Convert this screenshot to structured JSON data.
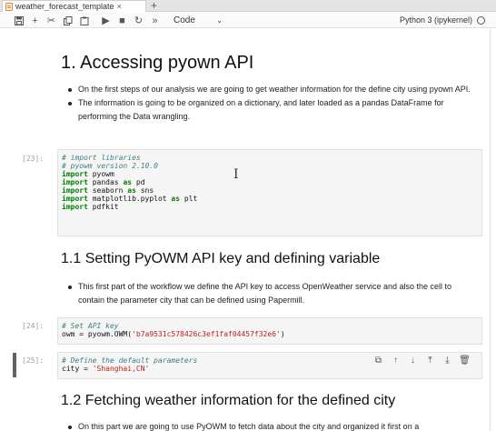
{
  "tab": {
    "label": "weather_forecast_template",
    "close": "×",
    "new_tab": "+"
  },
  "toolbar": {
    "icons": [
      "save-icon",
      "add-cell-icon",
      "cut-icon",
      "copy-icon",
      "paste-icon",
      "run-icon",
      "stop-icon",
      "restart-icon",
      "run-all-icon"
    ],
    "cell_type": "Code",
    "kernel": "Python 3 (ipykernel)"
  },
  "sections": {
    "h1": "1. Accessing pyown API",
    "h1_bullets": [
      "On the first steps of our analysis we are going to get weather information for the define city using pyown API.",
      "The information is going to be organized on a dictionary, and later loaded as a pandas DataFrame for performing the Data wrangling."
    ],
    "h2a": "1.1 Setting PyOWM API key and defining variable",
    "h2a_bullets": [
      "This first part of the workflow we define the API key to access OpenWeather service and also the cell to contain the parameter city that can be defined using Papermill."
    ],
    "h2b": "1.2 Fetching weather information for the defined city",
    "h2b_bullets": [
      "On this part we are going to use PyOWM to fetch data about the city and organized it first on a"
    ]
  },
  "cells": [
    {
      "prompt": "[23]:",
      "lines": [
        {
          "parts": [
            {
              "t": "# import libraries",
              "c": "cm"
            }
          ]
        },
        {
          "parts": [
            {
              "t": "# pyowm version 2.10.0",
              "c": "cm"
            }
          ]
        },
        {
          "parts": [
            {
              "t": "import",
              "c": "kw"
            },
            {
              "t": " pyowm",
              "c": ""
            }
          ]
        },
        {
          "parts": [
            {
              "t": "import",
              "c": "kw"
            },
            {
              "t": " pandas ",
              "c": ""
            },
            {
              "t": "as",
              "c": "kw"
            },
            {
              "t": " pd",
              "c": ""
            }
          ]
        },
        {
          "parts": [
            {
              "t": "import",
              "c": "kw"
            },
            {
              "t": " seaborn ",
              "c": ""
            },
            {
              "t": "as",
              "c": "kw"
            },
            {
              "t": " sns",
              "c": ""
            }
          ]
        },
        {
          "parts": [
            {
              "t": "import",
              "c": "kw"
            },
            {
              "t": " matplotlib.pyplot ",
              "c": ""
            },
            {
              "t": "as",
              "c": "kw"
            },
            {
              "t": " plt",
              "c": ""
            }
          ]
        },
        {
          "parts": [
            {
              "t": "import",
              "c": "kw"
            },
            {
              "t": " pdfkit",
              "c": ""
            }
          ]
        }
      ]
    },
    {
      "prompt": "[24]:",
      "lines": [
        {
          "parts": [
            {
              "t": "# Set API key",
              "c": "cm"
            }
          ]
        },
        {
          "parts": [
            {
              "t": "owm = pyowm.OWM(",
              "c": ""
            },
            {
              "t": "'b7a9531c578426c3ef1faf04457f32e6'",
              "c": "str"
            },
            {
              "t": ")",
              "c": ""
            }
          ]
        }
      ]
    },
    {
      "prompt": "[25]:",
      "lines": [
        {
          "parts": [
            {
              "t": "# Define the default parameters",
              "c": "cm"
            }
          ]
        },
        {
          "parts": [
            {
              "t": "city = ",
              "c": ""
            },
            {
              "t": "'Shanghai,CN'",
              "c": "str"
            }
          ]
        }
      ]
    }
  ],
  "cell_tools": [
    "duplicate-icon",
    "move-up-icon",
    "move-down-icon",
    "insert-above-icon",
    "insert-below-icon",
    "delete-icon"
  ]
}
